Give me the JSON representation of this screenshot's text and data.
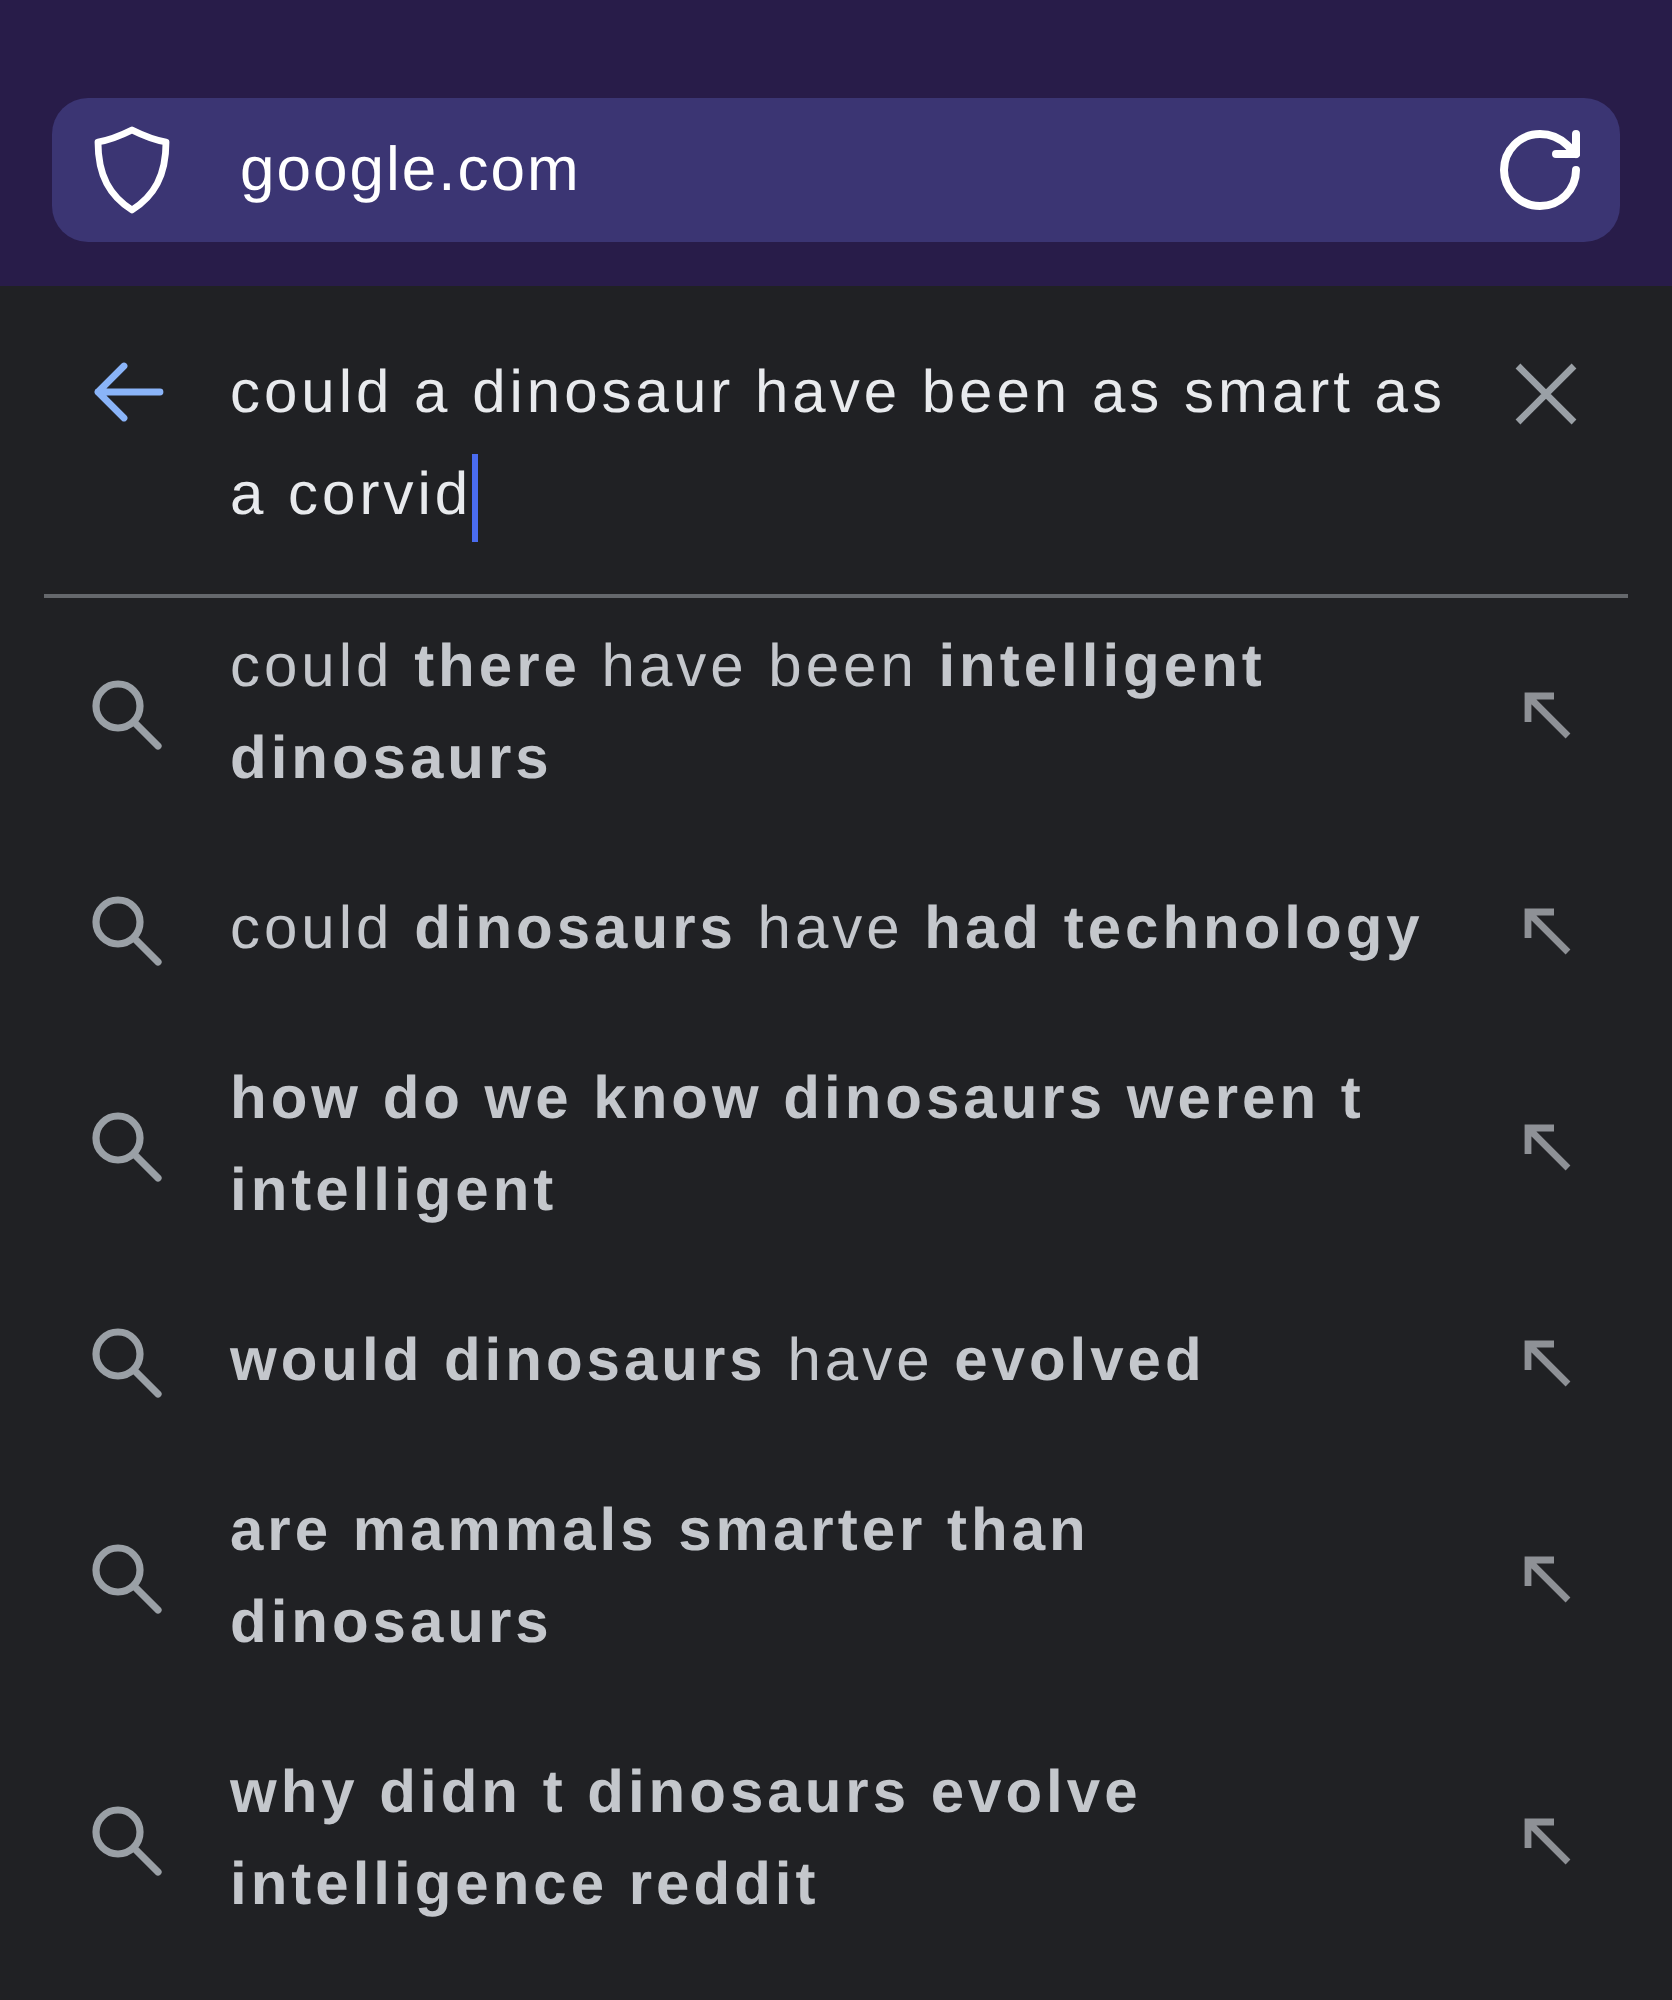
{
  "address_bar": {
    "url": "google.com"
  },
  "search": {
    "query": "could a dinosaur have been as smart as a corvid",
    "focused": true
  },
  "suggestions": [
    {
      "text": "could **there** have been **intelligent dinosaurs**",
      "all_bold": false
    },
    {
      "text": "could **dinosaurs** have **had technology**",
      "all_bold": false
    },
    {
      "text": "how do we know dinosaurs weren t intelligent",
      "all_bold": true
    },
    {
      "text": "**would dinosaurs** have **evolved**",
      "all_bold": false
    },
    {
      "text": "are mammals smarter than dinosaurs",
      "all_bold": true
    },
    {
      "text": "why didn t dinosaurs evolve intelligence reddit",
      "all_bold": true
    }
  ]
}
